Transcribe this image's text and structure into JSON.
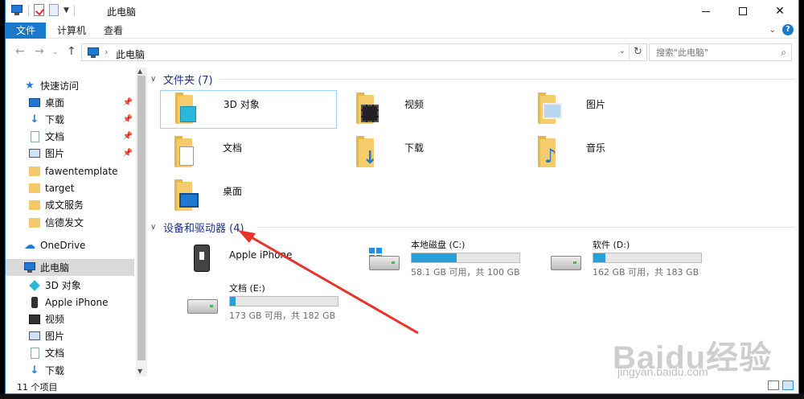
{
  "window": {
    "title": "此电脑",
    "controls": {
      "minimize": "—",
      "maximize": "□",
      "close": "✕"
    }
  },
  "ribbon": {
    "tabs": [
      "文件",
      "计算机",
      "查看"
    ]
  },
  "address": {
    "crumb": "此电脑",
    "search_placeholder": "搜索\"此电脑\""
  },
  "sidebar": {
    "quick_access": "快速访问",
    "items": [
      {
        "label": "快速访问",
        "icon": "star-icon"
      },
      {
        "label": "桌面",
        "icon": "desktop-icon",
        "pinned": true
      },
      {
        "label": "下载",
        "icon": "download-icon",
        "pinned": true
      },
      {
        "label": "文档",
        "icon": "documents-icon",
        "pinned": true
      },
      {
        "label": "图片",
        "icon": "pictures-icon",
        "pinned": true
      },
      {
        "label": "fawentemplate",
        "icon": "folder-icon"
      },
      {
        "label": "target",
        "icon": "folder-icon"
      },
      {
        "label": "成文服务",
        "icon": "folder-icon"
      },
      {
        "label": "信德发文",
        "icon": "folder-icon"
      },
      {
        "label": "OneDrive",
        "icon": "cloud-icon"
      },
      {
        "label": "此电脑",
        "icon": "computer-icon",
        "selected": true
      },
      {
        "label": "3D 对象",
        "icon": "cube-icon"
      },
      {
        "label": "Apple iPhone",
        "icon": "phone-icon"
      },
      {
        "label": "视频",
        "icon": "video-icon"
      },
      {
        "label": "图片",
        "icon": "pictures-icon"
      },
      {
        "label": "文档",
        "icon": "documents-icon"
      },
      {
        "label": "下载",
        "icon": "download-icon"
      }
    ]
  },
  "main": {
    "folders_header": "文件夹 (7)",
    "folders": [
      {
        "label": "3D 对象",
        "icon": "3d-objects-folder-icon",
        "selected": true
      },
      {
        "label": "视频",
        "icon": "videos-folder-icon"
      },
      {
        "label": "图片",
        "icon": "pictures-folder-icon"
      },
      {
        "label": "文档",
        "icon": "documents-folder-icon"
      },
      {
        "label": "下载",
        "icon": "downloads-folder-icon"
      },
      {
        "label": "音乐",
        "icon": "music-folder-icon"
      },
      {
        "label": "桌面",
        "icon": "desktop-folder-icon"
      }
    ],
    "devices_header": "设备和驱动器 (4)",
    "devices": [
      {
        "label": "Apple iPhone",
        "icon": "iphone-icon"
      },
      {
        "label": "本地磁盘 (C:)",
        "info": "58.1 GB 可用，共 100 GB",
        "used_fraction": 0.42,
        "icon": "system-drive-icon"
      },
      {
        "label": "软件 (D:)",
        "info": "162 GB 可用，共 183 GB",
        "used_fraction": 0.11,
        "icon": "drive-icon"
      },
      {
        "label": "文档 (E:)",
        "info": "173 GB 可用，共 182 GB",
        "used_fraction": 0.05,
        "icon": "drive-icon"
      }
    ]
  },
  "status": {
    "count": "11 个项目"
  },
  "watermark": {
    "logo": "Baidu经验",
    "url": "jingyan.baidu.com"
  },
  "colors": {
    "accent": "#1979ca",
    "header_text": "#1e3287",
    "drive_fill": "#26a0da",
    "annotation_arrow": "#e8322a"
  }
}
